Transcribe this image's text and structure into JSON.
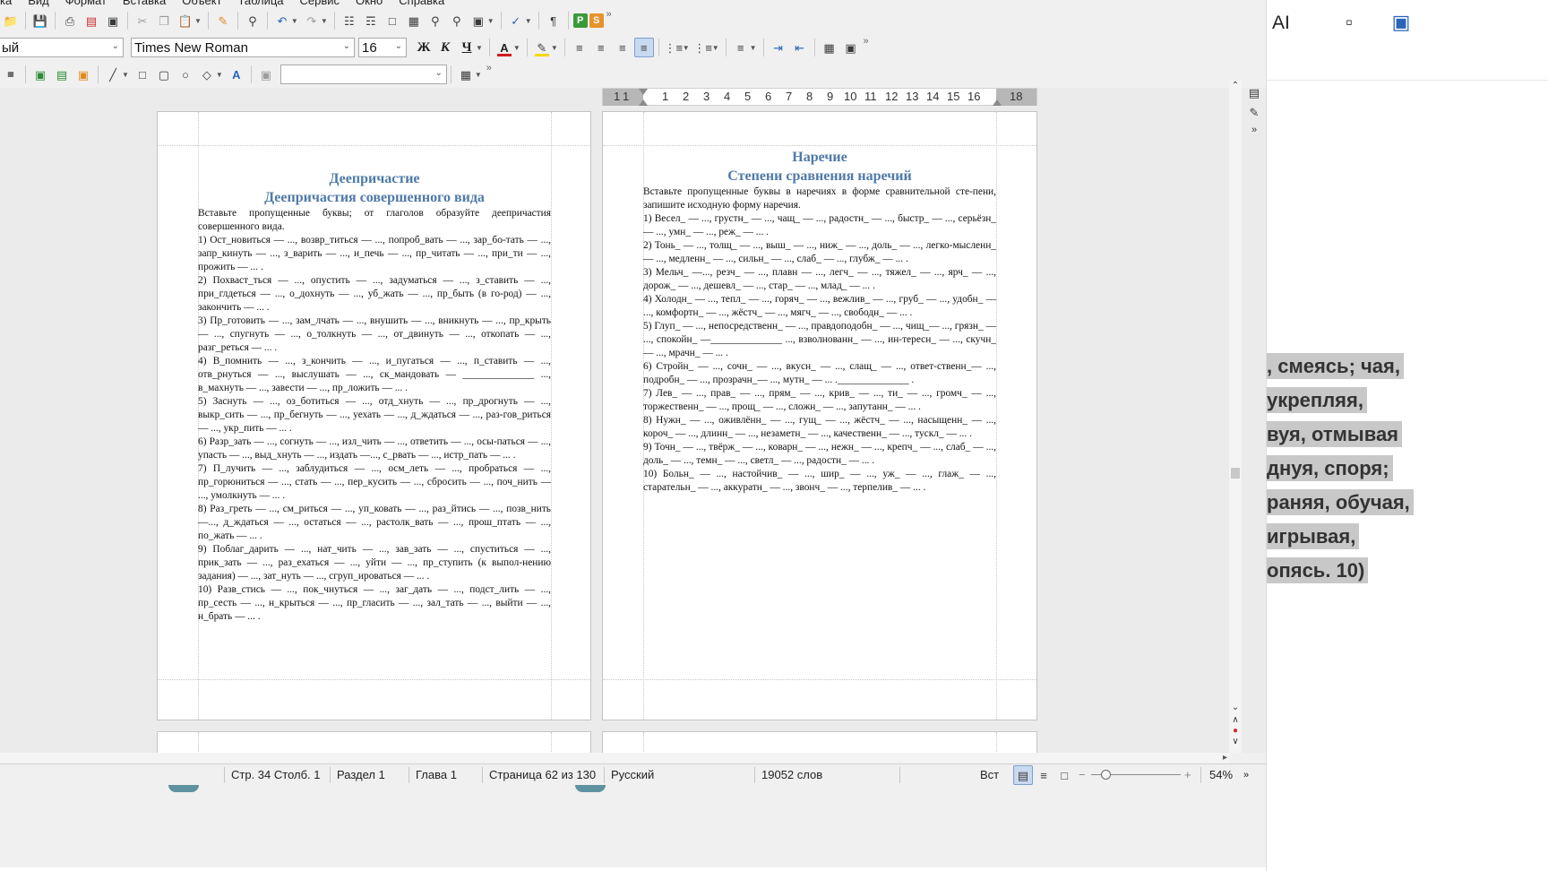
{
  "menubar": [
    "ка",
    "Вид",
    "Формат",
    "Вставка",
    "Объект",
    "Таблица",
    "Сервис",
    "Окно",
    "Справка"
  ],
  "toolbar": {
    "paragraph_style": "ый",
    "font_name": "Times New Roman",
    "font_size": "16",
    "bold_glyph": "Ж",
    "italic_glyph": "К",
    "underline_glyph": "Ч",
    "font_color_glyph": "A",
    "more_glyph": "»",
    "empty_combo_value": ""
  },
  "ruler": {
    "numbers": [
      "1",
      "1",
      "1",
      "2",
      "3",
      "4",
      "5",
      "6",
      "7",
      "8",
      "9",
      "10",
      "11",
      "12",
      "13",
      "14",
      "15",
      "16",
      "18"
    ]
  },
  "page_left": {
    "title1": "Деепричастие",
    "title2": "Деепричастия совершенного вида",
    "paragraphs": [
      "Вставьте пропущенные буквы; от глаголов образуйте деепричастия совершенного вида.",
      "1) Ост_новиться — ..., возвр_титься — ..., попроб_вать — ..., зар_бо-тать — ..., запр_кинуть — ..., з_варить — ..., и_печь — ..., пр_читать — ..., при_ти — ..., прожить — ... .",
      "2) Похваст_ться — ..., опустить — ..., задуматься — ..., з_ставить — ..., при_глдеться — ..., о_дохнуть — ..., уб_жать — ..., пр_быть (в го-род) — ..., закончить — ... .",
      "3) Пр_готовить — ..., зам_лчать — ..., внушить — ..., вникнуть — ..., пр_крыть — ..., спугнуть — ..., о_толкнуть — ..., от_двинуть — ..., откопать — ..., разг_реться — ... .",
      "4) В_помнить — ..., з_кончить — ..., и_пугаться — ..., п_ставить — ..., отв_рнуться — ..., выслушать — ..., ск_мандовать — ______________ ..., в_махнуть — ..., завести — ..., пр_ложить — ... .",
      "5) Заснуть — ..., оз_ботиться — ..., отд_хнуть — ..., пр_дрогнуть — ..., выкр_сить — ..., пр_бегнуть — ..., уехать — ..., д_ждаться — ..., раз-гов_риться — ..., укр_пить — ... .",
      "6) Разр_зать — ..., согнуть — ..., изл_чить — ..., ответить — ..., осы-паться — ..., упасть — ..., выд_хнуть — ..., издать —..., с_рвать — ..., истр_пать — ... .",
      "7) П_лучить — ..., заблудиться — ..., осм_леть — ..., пробраться — ..., пр_горюниться — ..., стать — ..., пер_кусить — ..., сбросить — ..., поч_нить — ..., умолкнуть — ... .",
      "8) Раз_греть — ..., см_риться — ..., уп_ковать — ..., раз_йтись — ..., позв_нить —..., д_ждаться — ..., остаться — ..., растолк_вать — ..., прош_птать — ..., по_жать — ... .",
      "9) Поблаг_дарить — ..., нат_чить — ..., зав_зать — ..., спуститься — ..., прик_зать — ..., раз_ехаться — ..., уйти — ..., пр_ступить (к выпол-нению задания) — ..., зат_нуть — ..., сгруп_ироваться — ... .",
      "10) Разв_стись — ..., пок_чнуться — ..., заг_дать — ..., подст_лить — ..., пр_сесть — ..., н_крыться — ..., пр_гласить — ..., зал_тать — ..., выйти — ..., н_брать — ... ."
    ]
  },
  "page_right": {
    "title1": "Наречие",
    "title2": "Степени сравнения наречий",
    "paragraphs": [
      "Вставьте пропущенные буквы в наречиях в форме сравнительной сте-пени, запишите исходную форму наречия.",
      "1) Весел_ — ..., грустн_ — ..., чащ_ — ..., радостн_ — ..., быстр_ — ..., серьёзн_ — ..., умн_ — ..., реж_ — ... .",
      "2) Тонь_ — ..., толщ_ — ..., выш_ — ..., ниж_ — ..., доль_ — ..., легко-мысленн_ — ..., медленн_ — ..., сильн_ — ..., слаб_ — ..., глубж_ — ... .",
      "3) Мельч_ —..., резч_ — ..., плавн — ..., легч_ — ..., тяжел_ — ..., ярч_ — ..., дорож_ — ..., дешевл_ — ..., стар_ — ..., млад_ — ... .",
      "4) Холодн_ — ..., тепл_ — ..., горяч_ — ..., вежлив_ — ..., груб_ — ..., удобн_ — ..., комфортн_ — ..., жёстч_ — ..., мягч_ — ..., свободн_ — ... .",
      "5) Глуп_ — ..., непосредственн_ — ..., правдоподобн_ — ..., чищ_— ..., грязн_ — ..., спокойн_ —______________ ..., взволнованн_ — ..., ин-тересн_ — ..., скучн_ — ..., мрачн_ — ... .",
      "6) Стройн_ — ..., сочн_ — ..., вкусн_ — ..., слащ_ — ..., ответ-ственн_— ..., подробн_ — ..., прозрачн_— ..., мутн_ — ... .______________ .",
      "7) Лев_ — ..., прав_ — ..., прям_ — ..., крив_ — ..., ти_ — ..., громч_ — ..., торжественн_ — ..., прощ_ — ..., сложн_ — ..., запутанн_ — ... .",
      "8) Нужн_ — ..., оживлённ_ — ..., гущ_ — ..., жёстч_ — ..., насыщенн_ — ..., короч_ — ..., длинн_ — ..., незаметн_ — ..., качественн_ — ..., тускл_ — ... .",
      "9) Точн_ — ..., твёрж_ — ..., коварн_ — ..., нежн_ — ..., крепч_ — ..., слаб_ — ..., доль_ — ..., темн_ — ..., светл_ — ..., радостн_ — ... .",
      "10) Больн_ — ..., настойчив_ — ..., шир_ — ..., уж_ — ..., глаж_ — ..., старательн_ — ..., аккуратн_ — ..., звонч_ — ..., терпелив_ — ... ."
    ]
  },
  "statusbar": {
    "page_col": "Стр. 34 Столб. 1",
    "section": "Раздел 1",
    "chapter": "Глава 1",
    "page_count": "Страница 62 из 130",
    "language": "Русский",
    "word_count": "19052 слов",
    "insert_mode": "Вст",
    "zoom": "54%"
  },
  "background_window": {
    "ai_label": "AI",
    "lines": [
      ", смеясь; чая,",
      "укрепляя,",
      "вуя, отмывая",
      "днуя, споря;",
      "раняя, обучая,",
      "игрывая,",
      "опясь. 10)"
    ]
  }
}
